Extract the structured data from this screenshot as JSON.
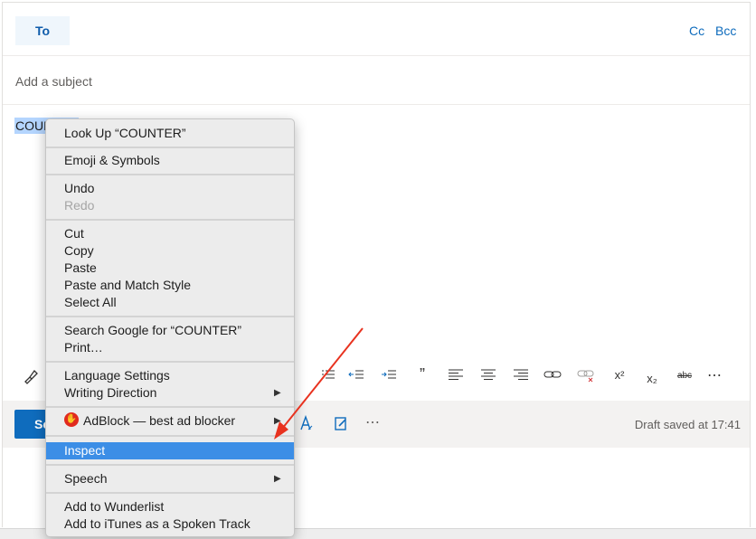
{
  "compose": {
    "to_label": "To",
    "cc_label": "Cc",
    "bcc_label": "Bcc",
    "subject_placeholder": "Add a subject",
    "body_text": "COUNTER"
  },
  "toolbar": {
    "icons": [
      "format-painter-icon",
      "decrease-indent-icon",
      "increase-indent-icon",
      "quote-icon",
      "align-left-icon",
      "align-center-icon",
      "align-right-icon",
      "link-icon",
      "unlink-icon",
      "superscript-icon",
      "subscript-icon",
      "strikethrough-icon",
      "more-icon"
    ],
    "quote_glyph": "”",
    "superscript": "x²",
    "subscript": "x₂",
    "strike": "abc",
    "more": "⋯"
  },
  "bottom": {
    "send_label": "Send",
    "draft_status": "Draft saved at 17:41",
    "more": "⋯"
  },
  "context_menu": {
    "look_up": "Look Up “COUNTER”",
    "emoji": "Emoji & Symbols",
    "undo": "Undo",
    "redo": "Redo",
    "cut": "Cut",
    "copy": "Copy",
    "paste": "Paste",
    "paste_match": "Paste and Match Style",
    "select_all": "Select All",
    "search_google": "Search Google for “COUNTER”",
    "print": "Print…",
    "language_settings": "Language Settings",
    "writing_direction": "Writing Direction",
    "adblock": "AdBlock — best ad blocker",
    "inspect": "Inspect",
    "speech": "Speech",
    "wunderlist": "Add to Wunderlist",
    "itunes": "Add to iTunes as a Spoken Track"
  },
  "colors": {
    "accent": "#0f6cbd",
    "highlight": "#3c8ee6",
    "annotation_arrow": "#e8321f"
  }
}
